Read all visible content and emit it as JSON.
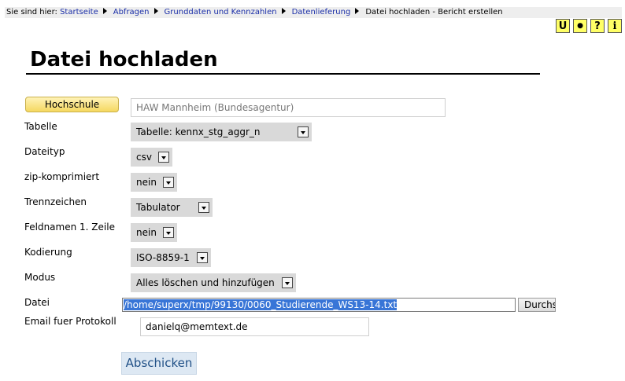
{
  "breadcrumb": {
    "prefix": "Sie sind hier:",
    "links": [
      "Startseite",
      "Abfragen",
      "Grunddaten und Kennzahlen",
      "Datenlieferung"
    ],
    "current": "Datei hochladen - Bericht erstellen"
  },
  "toolbar": {
    "buttons": [
      {
        "icon": "attachment-icon",
        "glyph": "U"
      },
      {
        "icon": "dot-icon",
        "glyph": "●"
      },
      {
        "icon": "help-icon",
        "glyph": "?"
      },
      {
        "icon": "info-icon",
        "glyph": "i"
      }
    ]
  },
  "page": {
    "title": "Datei hochladen"
  },
  "form": {
    "hochschule": {
      "label": "Hochschule",
      "value": "HAW Mannheim (Bundesagentur)"
    },
    "tabelle": {
      "label": "Tabelle",
      "value": "Tabelle: kennx_stg_aggr_n"
    },
    "dateityp": {
      "label": "Dateityp",
      "value": "csv"
    },
    "zip": {
      "label": "zip-komprimiert",
      "value": "nein"
    },
    "trennzeichen": {
      "label": "Trennzeichen",
      "value": "Tabulator"
    },
    "feldnamen": {
      "label": "Feldnamen 1. Zeile",
      "value": "nein"
    },
    "kodierung": {
      "label": "Kodierung",
      "value": "ISO-8859-1"
    },
    "modus": {
      "label": "Modus",
      "value": "Alles löschen und hinzufügen"
    },
    "datei": {
      "label": "Datei",
      "value": "/home/superx/tmp/99130/0060_Studierende_WS13-14.txt",
      "browse_label": "Durchsuchen..."
    },
    "email": {
      "label": "Email fuer Protokoll",
      "value": "danielq@memtext.de"
    },
    "submit_label": "Abschicken"
  },
  "colors": {
    "link": "#1a2ea8",
    "highlight": "#3875d7",
    "label_button": "#f5d860"
  }
}
